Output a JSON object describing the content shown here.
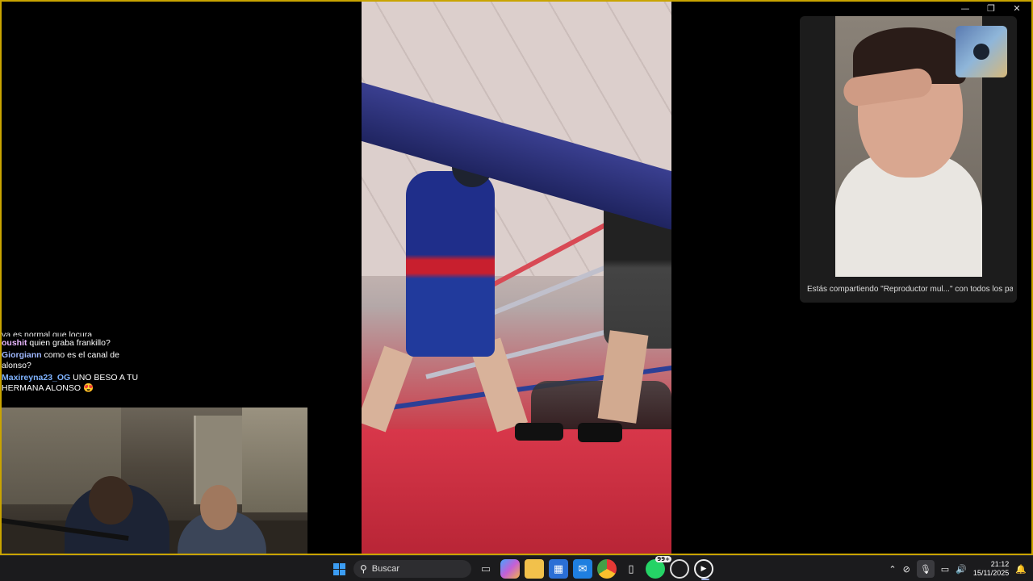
{
  "window": {
    "minimize": "—",
    "restore": "❐",
    "close": "✕"
  },
  "chat": {
    "partial": "ya es normal que locura",
    "messages": [
      {
        "user": "oushit",
        "color": "#e9b7ff",
        "text": "quien graba frankillo?"
      },
      {
        "user": "Giorgiann",
        "color": "#9fb8ff",
        "text": "como es el canal de alonso?"
      },
      {
        "user": "Maxireyna23_OG",
        "color": "#7fb3ff",
        "text": "UNO BESO A TU HERMANA ALONSO 😍"
      }
    ]
  },
  "call": {
    "sharing_notice": "Estás compartiendo \"Reproductor mul...\" con todos los part..."
  },
  "taskbar": {
    "search_placeholder": "Buscar",
    "whatsapp_badge": "99+",
    "time": "21:12",
    "date": "15/11/2025"
  }
}
